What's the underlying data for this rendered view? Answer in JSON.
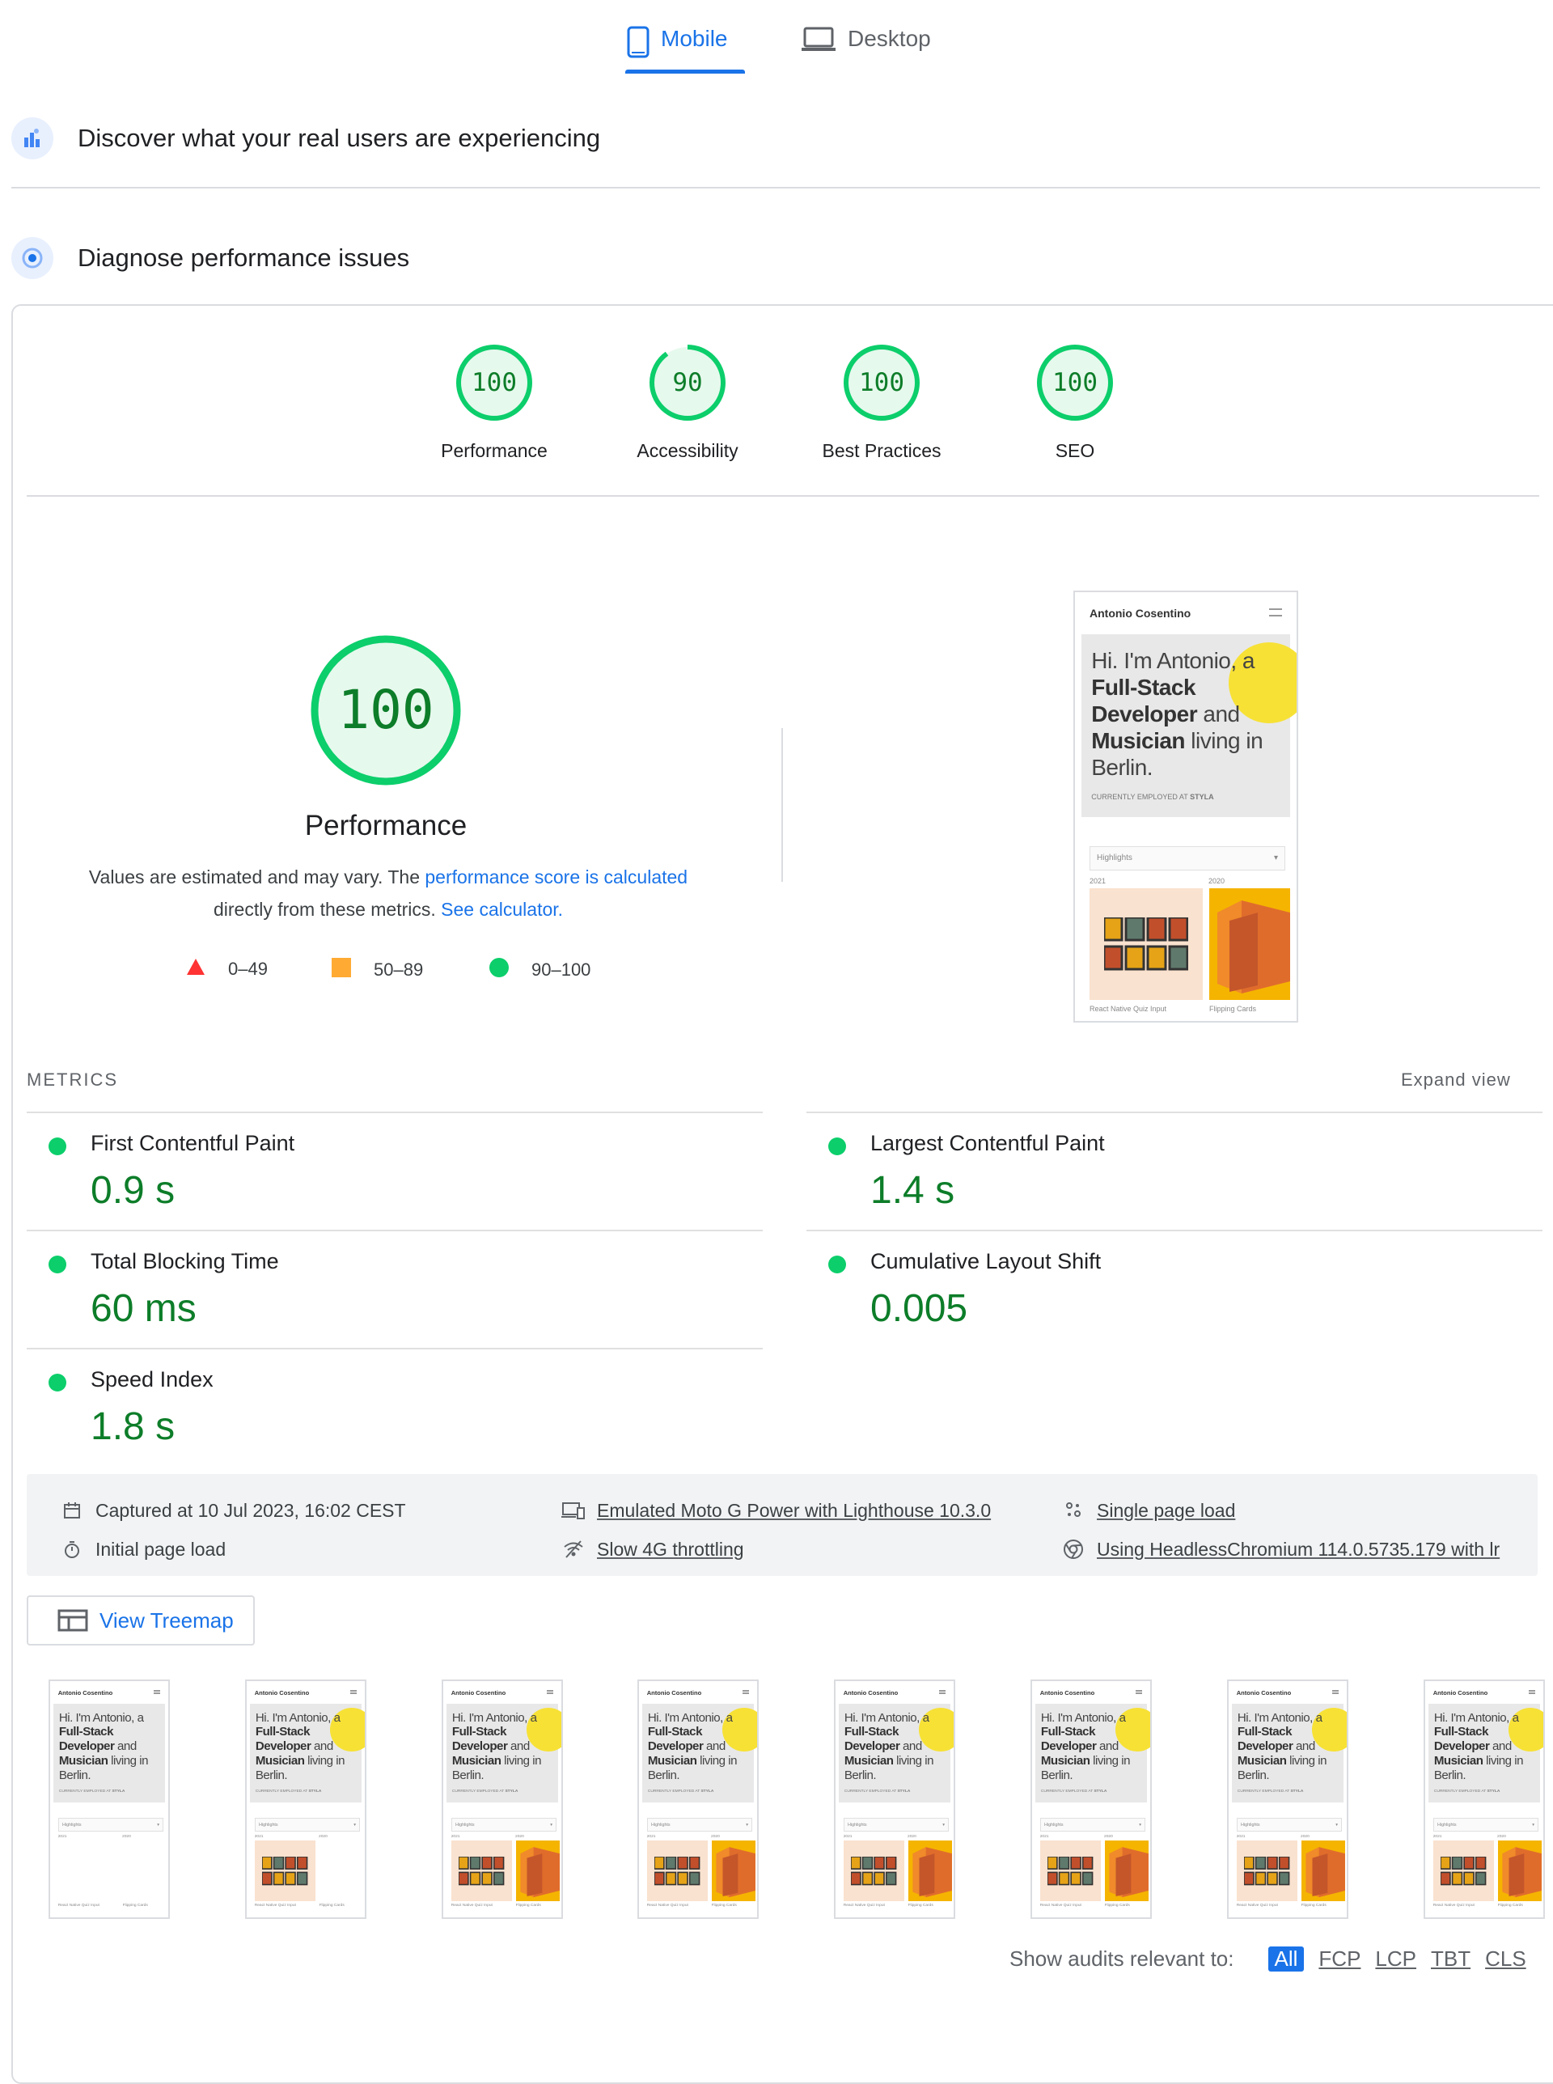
{
  "tabs": [
    {
      "label": "Mobile",
      "icon": "smartphone-icon",
      "active": true
    },
    {
      "label": "Desktop",
      "icon": "laptop-icon",
      "active": false
    }
  ],
  "sections": {
    "real_users": "Discover what your real users are experiencing",
    "diagnose": "Diagnose performance issues"
  },
  "categories": [
    {
      "label": "Performance",
      "score": "100",
      "fraction": 1.0
    },
    {
      "label": "Accessibility",
      "score": "90",
      "fraction": 0.9
    },
    {
      "label": "Best Practices",
      "score": "100",
      "fraction": 1.0
    },
    {
      "label": "SEO",
      "score": "100",
      "fraction": 1.0
    }
  ],
  "performance": {
    "score": "100",
    "title": "Performance",
    "desc_prefix": "Values are estimated and may vary. The ",
    "desc_link": "performance score is calculated",
    "desc_mid": "directly from these metrics. ",
    "desc_link2": "See calculator."
  },
  "legend": [
    {
      "range": "0–49",
      "shape": "triangle",
      "color": "#ff3333"
    },
    {
      "range": "50–89",
      "shape": "square",
      "color": "#ffaa33"
    },
    {
      "range": "90–100",
      "shape": "circle",
      "color": "#0cce6b"
    }
  ],
  "screenshot": {
    "site_name": "Antonio Cosentino",
    "hero_line1": "Hi. I'm Antonio, a",
    "hero_bold1": "Full-Stack",
    "hero_bold2": "Developer",
    "hero_and": " and",
    "hero_bold3": "Musician",
    "hero_living": " living in",
    "hero_city": "Berlin.",
    "employed": "CURRENTLY EMPLOYED AT",
    "employer": "STYLA",
    "select": "Highlights",
    "year1": "2021",
    "year2": "2020",
    "caption1": "React Native Quiz Input",
    "caption2": "Flipping Cards"
  },
  "metrics": {
    "label": "METRICS",
    "expand": "Expand view",
    "items": [
      {
        "name": "First Contentful Paint",
        "value": "0.9 s"
      },
      {
        "name": "Largest Contentful Paint",
        "value": "1.4 s"
      },
      {
        "name": "Total Blocking Time",
        "value": "60 ms"
      },
      {
        "name": "Cumulative Layout Shift",
        "value": "0.005"
      },
      {
        "name": "Speed Index",
        "value": "1.8 s"
      }
    ]
  },
  "info": {
    "captured": "Captured at 10 Jul 2023, 16:02 CEST",
    "initial": "Initial page load",
    "device": "Emulated Moto G Power with Lighthouse 10.3.0",
    "throttle": "Slow 4G throttling",
    "single": "Single page load",
    "browser": "Using HeadlessChromium 114.0.5735.179 with lr"
  },
  "treemap": "View Treemap",
  "filter": {
    "label": "Show audits relevant to:",
    "options": [
      "All",
      "FCP",
      "LCP",
      "TBT",
      "CLS"
    ]
  },
  "colors": {
    "accent": "#1a73e8",
    "pass": "#0cce6b",
    "pass_text": "#0d7d29"
  }
}
